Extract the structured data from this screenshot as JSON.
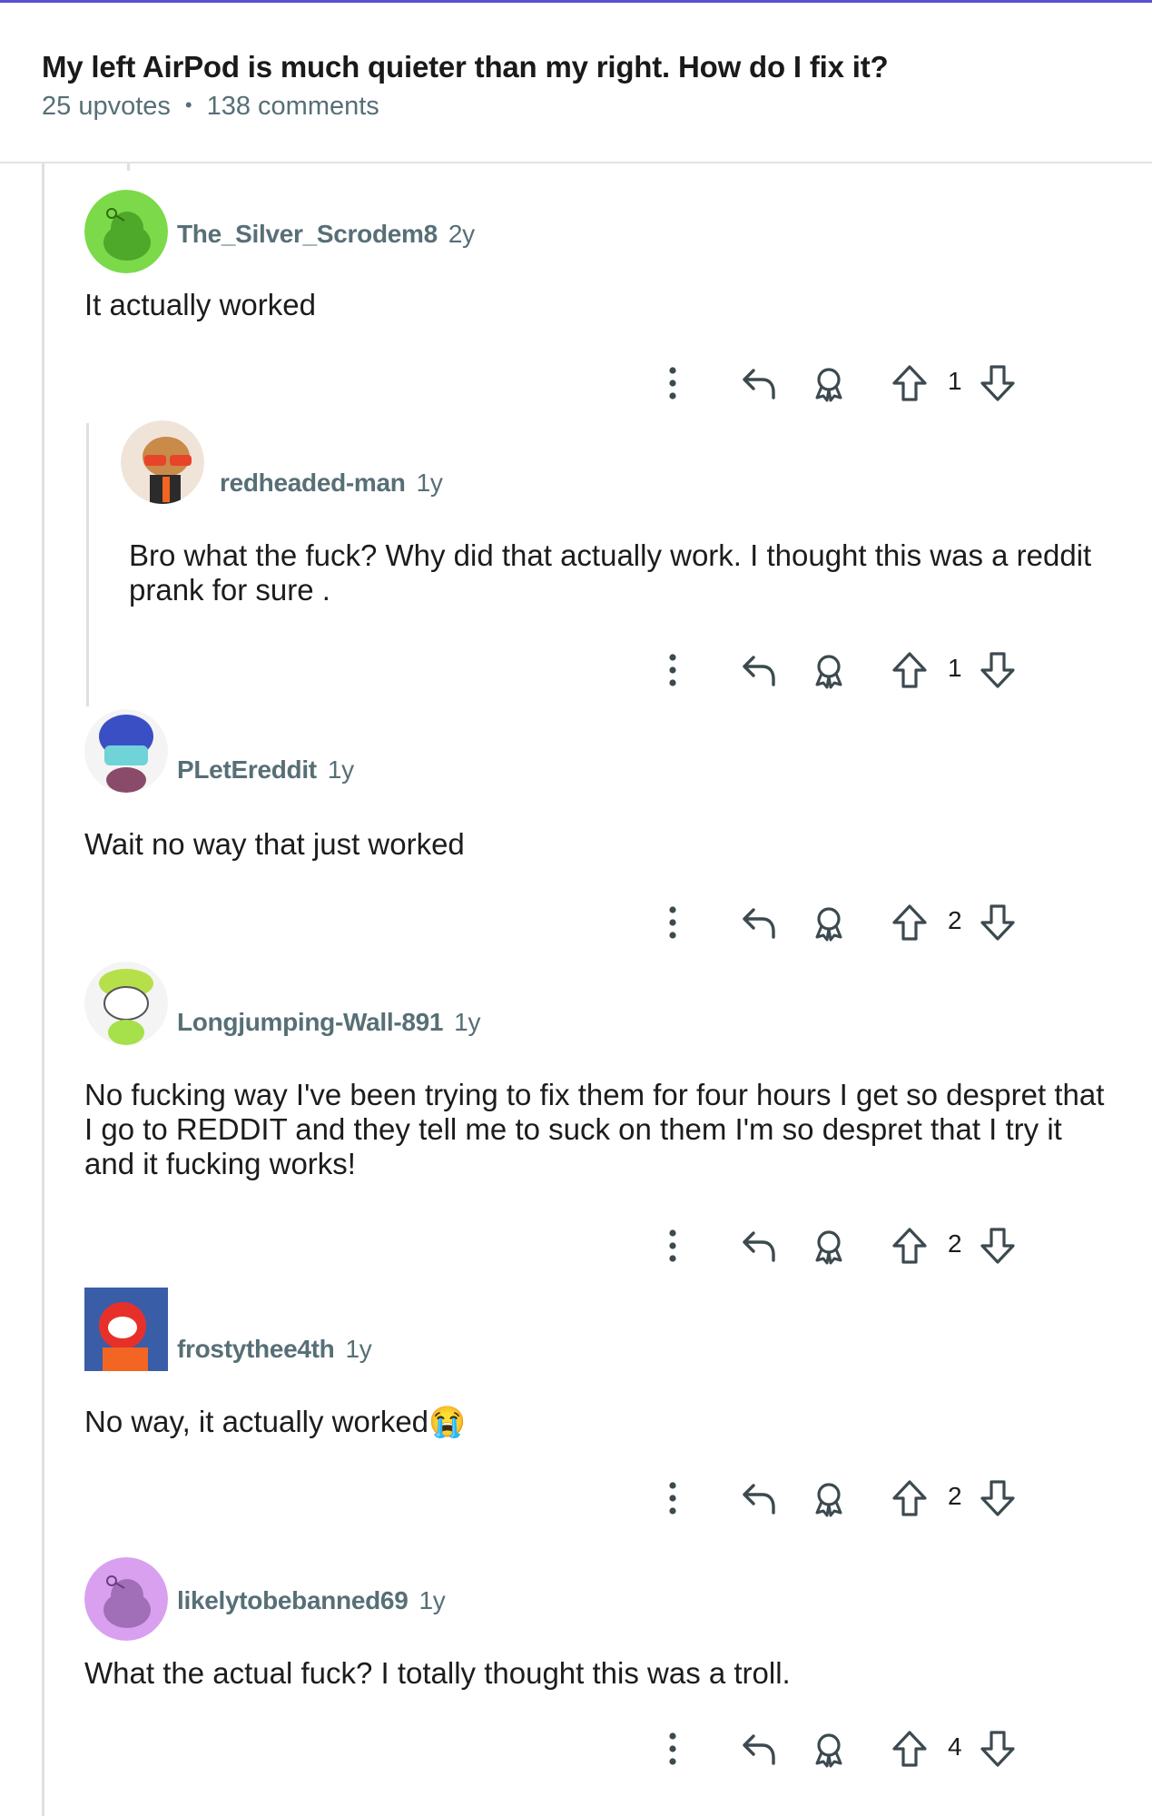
{
  "post": {
    "title": "My left AirPod is much quieter than my right. How do I fix it?",
    "upvotes": "25 upvotes",
    "separator": "•",
    "comments": "138 comments"
  },
  "comments": [
    {
      "username": "The_Silver_Scrodem8",
      "age": "2y",
      "body": "It actually worked",
      "score": "1",
      "avatar_color": "#7cd94a"
    },
    {
      "username": "redheaded-man",
      "age": "1y",
      "body": "Bro what the fuck? Why did that actually work. I thought this was a reddit prank for sure .",
      "score": "1",
      "avatar_color": "#f0e4d8"
    },
    {
      "username": "PLetEreddit",
      "age": "1y",
      "body": "Wait no way that just worked",
      "score": "2",
      "avatar_color": "#3b4fc4"
    },
    {
      "username": "Longjumping-Wall-891",
      "age": "1y",
      "body": "No fucking way I've been trying to fix them for four hours I get so despret that I go to REDDIT and they tell me to suck on them I'm so despret that I try it and it fucking works!",
      "score": "2",
      "avatar_color": "#b5e04a"
    },
    {
      "username": "frostythee4th",
      "age": "1y",
      "body": "No way, it actually worked😭",
      "score": "2",
      "avatar_color": "#3a5da8"
    },
    {
      "username": "likelytobebanned69",
      "age": "1y",
      "body": "What the actual fuck? I totally thought this was a troll.",
      "score": "4",
      "avatar_color": "#d9a0f0"
    }
  ],
  "icons": {
    "more": "more-vertical-icon",
    "reply": "reply-arrow-icon",
    "award": "award-icon",
    "upvote": "upvote-arrow-icon",
    "downvote": "downvote-arrow-icon"
  }
}
